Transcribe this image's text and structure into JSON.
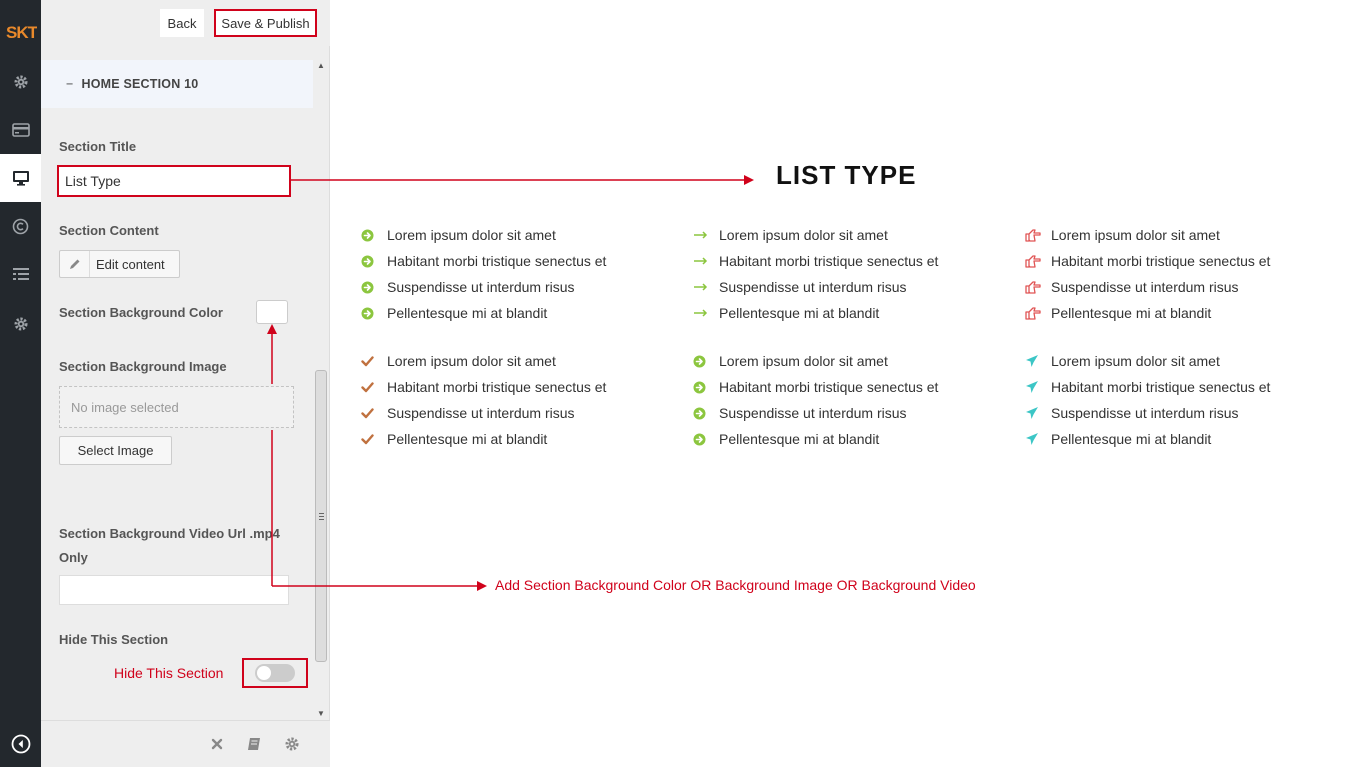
{
  "brand": {
    "logo_text": "SKT"
  },
  "rail": {
    "items": [
      {
        "icon": "gear-icon"
      },
      {
        "icon": "card-icon"
      },
      {
        "icon": "monitor-icon",
        "active": true
      },
      {
        "icon": "copyright-icon"
      },
      {
        "icon": "list-icon"
      },
      {
        "icon": "gear-icon"
      }
    ],
    "bottom_icon": "collapse-arrow-icon"
  },
  "toolbar": {
    "back_label": "Back",
    "publish_label": "Save & Publish"
  },
  "section": {
    "heading": "HOME SECTION 10",
    "title_label": "Section Title",
    "title_value": "List Type",
    "content_label": "Section Content",
    "edit_content_label": "Edit content",
    "bg_color_label": "Section Background Color",
    "bg_color_value": "#ffffff",
    "bg_image_label": "Section Background Image",
    "no_image_text": "No image selected",
    "select_image_label": "Select Image",
    "video_label": "Section Background Video Url .mp4 Only",
    "video_value": "",
    "hide_label": "Hide This Section",
    "hide_value": false
  },
  "annotations": {
    "hide_section": "Hide This Section",
    "background": "Add Section Background Color OR Background Image OR Background Video"
  },
  "preview": {
    "title": "LIST TYPE",
    "lists": [
      {
        "icon": "circle-arrow-icon",
        "color": "#8cc63f",
        "items": [
          "Lorem ipsum dolor sit amet",
          "Habitant morbi tristique senectus et",
          "Suspendisse ut interdum risus",
          "Pellentesque mi at blandit"
        ]
      },
      {
        "icon": "long-arrow-icon",
        "color": "#8cc63f",
        "items": [
          "Lorem ipsum dolor sit amet",
          "Habitant morbi tristique senectus et",
          "Suspendisse ut interdum risus",
          "Pellentesque mi at blandit"
        ]
      },
      {
        "icon": "thumbs-right-icon",
        "color": "#e05555",
        "items": [
          "Lorem ipsum dolor sit amet",
          "Habitant morbi tristique senectus et",
          "Suspendisse ut interdum risus",
          "Pellentesque mi at blandit"
        ]
      },
      {
        "icon": "check-icon",
        "color": "#c0713f",
        "items": [
          "Lorem ipsum dolor sit amet",
          "Habitant morbi tristique senectus et",
          "Suspendisse ut interdum risus",
          "Pellentesque mi at blandit"
        ]
      },
      {
        "icon": "circle-arrow-icon",
        "color": "#8cc63f",
        "items": [
          "Lorem ipsum dolor sit amet",
          "Habitant morbi tristique senectus et",
          "Suspendisse ut interdum risus",
          "Pellentesque mi at blandit"
        ]
      },
      {
        "icon": "plane-icon",
        "color": "#3cc6c6",
        "items": [
          "Lorem ipsum dolor sit amet",
          "Habitant morbi tristique senectus et",
          "Suspendisse ut interdum risus",
          "Pellentesque mi at blandit"
        ]
      }
    ]
  },
  "footer": {
    "icons": [
      "close-icon",
      "book-icon",
      "gear-icon"
    ]
  },
  "colors": {
    "accent_red": "#d0021b",
    "rail_bg": "#23282d",
    "logo_orange": "#e8892b"
  }
}
